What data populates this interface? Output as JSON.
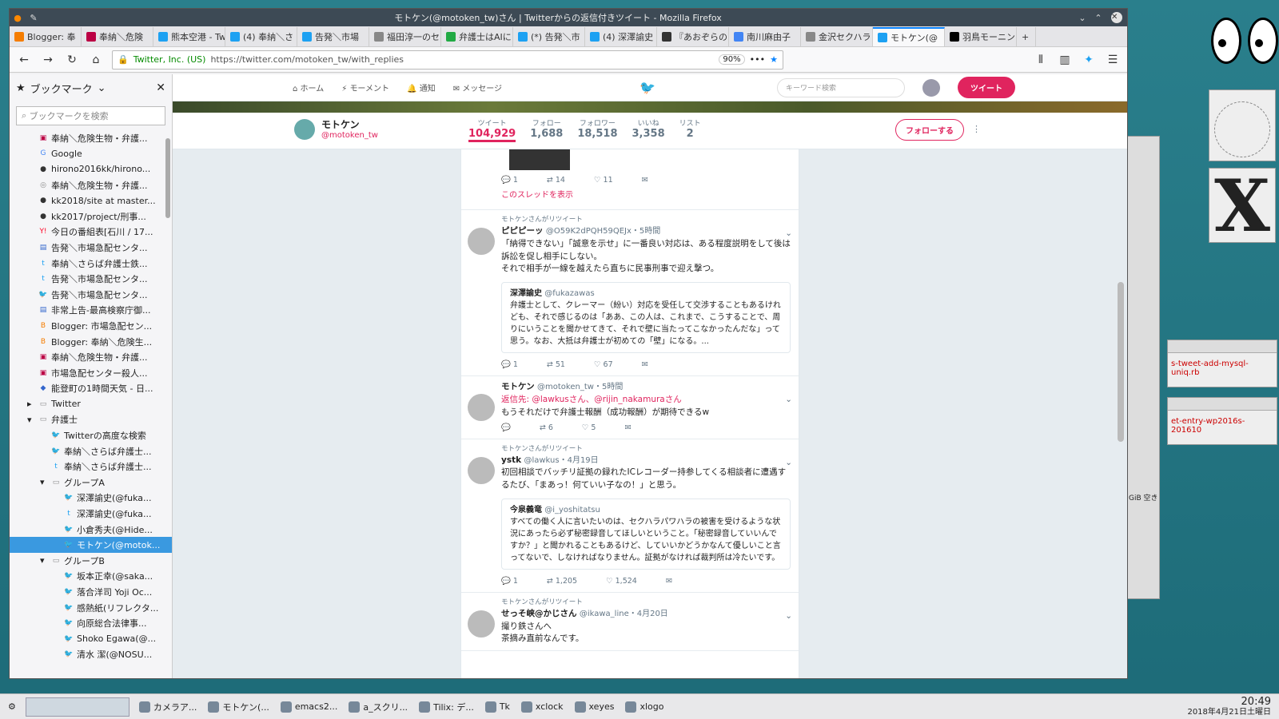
{
  "window": {
    "title": "モトケン(@motoken_tw)さん | Twitterからの返信付きツイート - Mozilla Firefox"
  },
  "tabs": [
    {
      "label": "Blogger: 奉",
      "color": "#f57d00"
    },
    {
      "label": "奉納＼危険",
      "color": "#b04"
    },
    {
      "label": "熊本空港 - Tw",
      "color": "#1da1f2"
    },
    {
      "label": "(4) 奉納＼さ",
      "color": "#1da1f2"
    },
    {
      "label": "告発＼市場",
      "color": "#1da1f2"
    },
    {
      "label": "福田淳一のセク",
      "color": "#888"
    },
    {
      "label": "弁護士はAIに",
      "color": "#2a4"
    },
    {
      "label": "(*) 告発＼市",
      "color": "#1da1f2"
    },
    {
      "label": "(4) 深澤諭史",
      "color": "#1da1f2"
    },
    {
      "label": "『あおぞらの",
      "color": "#333"
    },
    {
      "label": "南川麻由子",
      "color": "#4285f4"
    },
    {
      "label": "金沢セクハラ",
      "color": "#888"
    },
    {
      "label": "モトケン(@",
      "color": "#1da1f2"
    },
    {
      "label": "羽鳥モーニン",
      "color": "#000"
    }
  ],
  "urlbar": {
    "org": "Twitter, Inc. (US)",
    "url": "https://twitter.com/motoken_tw/with_replies",
    "zoom": "90%"
  },
  "sidebar": {
    "title": "ブックマーク",
    "search_placeholder": "ブックマークを検索",
    "items": [
      {
        "label": "奉納＼危険生物・弁護...",
        "indent": 0,
        "icon": "photo",
        "color": "#b04"
      },
      {
        "label": "Google",
        "indent": 0,
        "icon": "G",
        "color": "#4285f4"
      },
      {
        "label": "hirono2016kk/hirono...",
        "indent": 0,
        "icon": "gh",
        "color": "#333"
      },
      {
        "label": "奉納＼危険生物・弁護...",
        "indent": 0,
        "icon": "globe",
        "color": "#888"
      },
      {
        "label": "kk2018/site at master...",
        "indent": 0,
        "icon": "gh",
        "color": "#333"
      },
      {
        "label": "kk2017/project/刑事...",
        "indent": 0,
        "icon": "gh",
        "color": "#333"
      },
      {
        "label": "今日の番組表[石川 / 17...",
        "indent": 0,
        "icon": "Y!",
        "color": "#f02"
      },
      {
        "label": "告発＼市場急配センタ...",
        "indent": 0,
        "icon": "doc",
        "color": "#36c"
      },
      {
        "label": "奉納＼さらば弁護士鉄...",
        "indent": 0,
        "icon": "t",
        "color": "#1da1f2"
      },
      {
        "label": "告発＼市場急配センタ...",
        "indent": 0,
        "icon": "t",
        "color": "#1da1f2"
      },
      {
        "label": "告発＼市場急配センタ...",
        "indent": 0,
        "icon": "bird",
        "color": "#1da1f2"
      },
      {
        "label": "非常上告-最高検察庁御...",
        "indent": 0,
        "icon": "doc",
        "color": "#36c"
      },
      {
        "label": "Blogger: 市場急配セン...",
        "indent": 0,
        "icon": "B",
        "color": "#f57d00"
      },
      {
        "label": "Blogger: 奉納＼危険生...",
        "indent": 0,
        "icon": "B",
        "color": "#f57d00"
      },
      {
        "label": "奉納＼危険生物・弁護...",
        "indent": 0,
        "icon": "photo",
        "color": "#b04"
      },
      {
        "label": "市場急配センター殺人...",
        "indent": 0,
        "icon": "photo",
        "color": "#b04"
      },
      {
        "label": "能登町の1時間天気 - 日...",
        "indent": 0,
        "icon": "cube",
        "color": "#36c"
      },
      {
        "label": "Twitter",
        "indent": 0,
        "icon": "folder",
        "color": "#888",
        "expander": "▸"
      },
      {
        "label": "弁護士",
        "indent": 0,
        "icon": "folder",
        "color": "#888",
        "expander": "▾"
      },
      {
        "label": "Twitterの高度な検索",
        "indent": 1,
        "icon": "bird",
        "color": "#1da1f2"
      },
      {
        "label": "奉納＼さらば弁護士...",
        "indent": 1,
        "icon": "bird",
        "color": "#1da1f2"
      },
      {
        "label": "奉納＼さらば弁護士...",
        "indent": 1,
        "icon": "t",
        "color": "#1da1f2"
      },
      {
        "label": "グループA",
        "indent": 1,
        "icon": "folder",
        "color": "#888",
        "expander": "▾"
      },
      {
        "label": "深澤諭史(@fuka...",
        "indent": 2,
        "icon": "bird",
        "color": "#1da1f2"
      },
      {
        "label": "深澤諭史(@fuka...",
        "indent": 2,
        "icon": "t",
        "color": "#1da1f2"
      },
      {
        "label": "小倉秀夫(@Hide...",
        "indent": 2,
        "icon": "bird",
        "color": "#1da1f2"
      },
      {
        "label": "モトケン(@motok...",
        "indent": 2,
        "icon": "bird",
        "color": "#1da1f2",
        "selected": true
      },
      {
        "label": "グループB",
        "indent": 1,
        "icon": "folder",
        "color": "#888",
        "expander": "▾"
      },
      {
        "label": "坂本正幸(@saka...",
        "indent": 2,
        "icon": "bird",
        "color": "#1da1f2"
      },
      {
        "label": "落合洋司 Yoji Oc...",
        "indent": 2,
        "icon": "bird",
        "color": "#1da1f2"
      },
      {
        "label": "感熱紙(リフレクタ...",
        "indent": 2,
        "icon": "bird",
        "color": "#1da1f2"
      },
      {
        "label": "向原総合法律事...",
        "indent": 2,
        "icon": "bird",
        "color": "#1da1f2"
      },
      {
        "label": "Shoko Egawa(@...",
        "indent": 2,
        "icon": "bird",
        "color": "#1da1f2"
      },
      {
        "label": "清水 潔(@NOSU...",
        "indent": 2,
        "icon": "bird",
        "color": "#1da1f2"
      }
    ]
  },
  "twitter": {
    "nav": {
      "home": "ホーム",
      "moments": "モーメント",
      "notifications": "通知",
      "messages": "メッセージ",
      "search_placeholder": "キーワード検索",
      "tweet_button": "ツイート"
    },
    "profile": {
      "name": "モトケン",
      "handle": "@motoken_tw",
      "follow_label": "フォローする",
      "stats": [
        {
          "label": "ツイート",
          "value": "104,929",
          "active": true
        },
        {
          "label": "フォロー",
          "value": "1,688"
        },
        {
          "label": "フォロワー",
          "value": "18,518"
        },
        {
          "label": "いいね",
          "value": "3,358"
        },
        {
          "label": "リスト",
          "value": "2"
        }
      ]
    },
    "tweets": [
      {
        "retweet_note": "",
        "name": "",
        "handle": "",
        "time": "",
        "reply_to": "",
        "text": "",
        "quote": null,
        "replies": "1",
        "retweets": "14",
        "likes": "11",
        "thread": "このスレッドを表示",
        "partial": true
      },
      {
        "retweet_note": "モトケンさんがリツイート",
        "name": "ピピピーッ",
        "handle": "@O59K2dPQH59QEJx",
        "time": "・5時間",
        "reply_to": "",
        "text": "「納得できない」「誠意を示せ」に一番良い対応は、ある程度説明をして後は訴訟を促し相手にしない。\nそれで相手が一線を越えたら直ちに民事刑事で迎え撃つ。",
        "quote": {
          "name": "深澤諭史",
          "handle": "@fukazawas",
          "text": "弁護士として、クレーマー（紛い）対応を受任して交渉することもあるけれども、それで感じるのは「ああ、この人は、これまで、こうすることで、周りにいうことを聞かせてきて、それで壁に当たってこなかったんだな」って思う。なお、大抵は弁護士が初めての「壁」になる。..."
        },
        "replies": "1",
        "retweets": "51",
        "likes": "67",
        "thread": ""
      },
      {
        "retweet_note": "",
        "name": "モトケン",
        "handle": "@motoken_tw",
        "time": "・5時間",
        "reply_to": "返信先: @lawkusさん、@rijin_nakamuraさん",
        "text": "もうそれだけで弁護士報酬（成功報酬）が期待できるw",
        "quote": null,
        "replies": "",
        "retweets": "6",
        "likes": "5",
        "thread": ""
      },
      {
        "retweet_note": "モトケンさんがリツイート",
        "name": "ystk",
        "handle": "@lawkus",
        "time": "・4月19日",
        "reply_to": "",
        "text": "初回相談でバッチリ証拠の録れたICレコーダー持参してくる相談者に遭遇するたび、「まあっ！何ていい子なの！」と思う。",
        "quote": {
          "name": "今泉義竜",
          "handle": "@i_yoshitatsu",
          "text": "すべての働く人に言いたいのは、セクハラパワハラの被害を受けるような状況にあったら必ず秘密録音してほしいということ。「秘密録音していいんですか？」と聞かれることもあるけど、していいかどうかなんて優しいこと言ってないで、しなければなりません。証拠がなければ裁判所は冷たいです。"
        },
        "replies": "1",
        "retweets": "1,205",
        "likes": "1,524",
        "thread": ""
      },
      {
        "retweet_note": "モトケンさんがリツイート",
        "name": "せっそ峡@かじさん",
        "handle": "@ikawa_line",
        "time": "・4月20日",
        "reply_to": "",
        "text": "撮り鉄さんへ\n茶摘み直前なんです。",
        "quote": null,
        "replies": "",
        "retweets": "",
        "likes": "",
        "thread": ""
      }
    ]
  },
  "taskbar": {
    "items": [
      "カメラア...",
      "モトケン(...",
      "emacs2...",
      "a_スクリ...",
      "Tilix: デ...",
      "Tk",
      "xclock",
      "xeyes",
      "xlogo"
    ],
    "time": "20:49",
    "date": "2018年4月21日土曜日"
  },
  "widgets": {
    "tk1": "s-tweet-add-mysql-uniq.rb",
    "tk2": "et-entry-wp2016s-201610",
    "disk": "GiB 空き"
  }
}
